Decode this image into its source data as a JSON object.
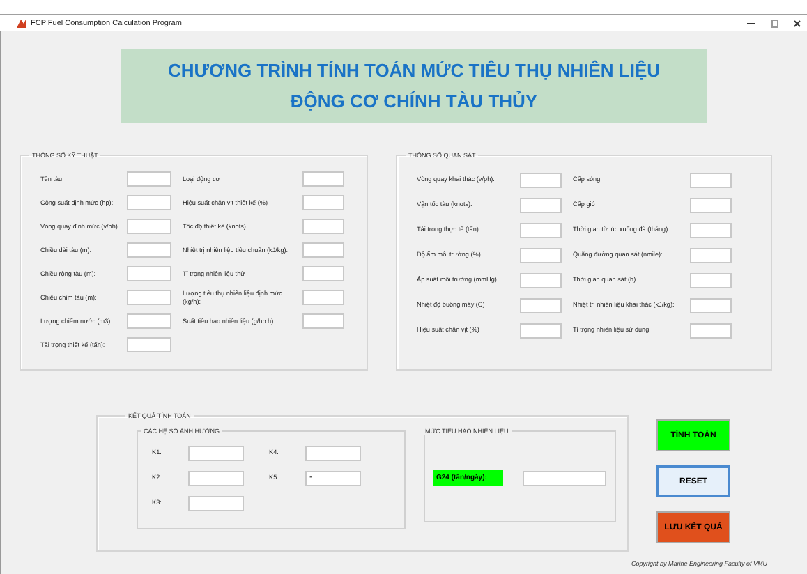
{
  "window": {
    "title": "FCP Fuel Consumption Calculation Program"
  },
  "banner": {
    "lines": [
      "CHƯƠNG TRÌNH TÍNH TOÁN MỨC TIÊU THỤ NHIÊN LIỆU",
      "ĐỘNG CƠ CHÍNH TÀU THỦY"
    ]
  },
  "technical": {
    "title": "THÔNG SỐ KỸ THUẬT",
    "columns": [
      [
        {
          "label": "Tên tàu"
        },
        {
          "label": "Công suất định mức (hp):"
        },
        {
          "label": "Vòng quay định mức (v/ph)"
        },
        {
          "label": "Chiều dài tàu (m):"
        },
        {
          "label": "Chiều rộng tàu (m):"
        },
        {
          "label": "Chiều chìm tàu (m):"
        },
        {
          "label": "Lượng chiếm nước (m3):"
        },
        {
          "label": "Tải trọng thiết kế (tấn):"
        }
      ],
      [
        {
          "label": "Loại động cơ"
        },
        {
          "label": "Hiệu suất chân vịt thiết kế (%)"
        },
        {
          "label": "Tốc độ thiết kế (knots)"
        },
        {
          "label": "Nhiệt trị nhiên liệu tiêu chuẩn (kJ/kg):"
        },
        {
          "label": "Tỉ trọng nhiên liệu thử"
        },
        {
          "label": "Lượng tiêu thụ nhiên liệu định mức (kg/h):"
        },
        {
          "label": "Suất tiêu hao nhiên liệu (g/hp.h):"
        }
      ]
    ]
  },
  "observed": {
    "title": "THÔNG SỐ QUAN SÁT",
    "columns": [
      [
        {
          "label": "Vòng quay khai thác (v/ph):"
        },
        {
          "label": "Vận tốc tàu (knots):"
        },
        {
          "label": "Tải trọng thực tế (tấn):"
        },
        {
          "label": "Độ ẩm môi trường (%)"
        },
        {
          "label": "Áp suất môi trường (mmHg)"
        },
        {
          "label": "Nhiệt độ buồng máy (C)"
        },
        {
          "label": "Hiệu suất chân vịt (%)"
        }
      ],
      [
        {
          "label": "Cấp sóng"
        },
        {
          "label": "Cấp gió"
        },
        {
          "label": "Thời gian từ lúc xuống đà (tháng):"
        },
        {
          "label": "Quãng đường quan sát (nmile):"
        },
        {
          "label": "Thời gian quan sát (h)"
        },
        {
          "label": "Nhiệt trị nhiên liệu khai thác (kJ/kg):"
        },
        {
          "label": "Tỉ trọng nhiên liệu sử dụng"
        }
      ]
    ]
  },
  "results": {
    "title": "KẾT QUẢ TÍNH TOÁN",
    "coefficients": {
      "title": "CÁC HỆ SỐ ẢNH HƯỞNG",
      "columns": [
        [
          {
            "label": "K1:"
          },
          {
            "label": "K2:"
          },
          {
            "label": "K3:"
          }
        ],
        [
          {
            "label": "K4:"
          },
          {
            "label": "K5:",
            "value": "-"
          }
        ]
      ]
    },
    "consumption": {
      "title": "MỨC TIÊU HAO NHIÊN LIỆU",
      "label": "G24 (tấn/ngày):"
    }
  },
  "buttons": [
    {
      "label": "TÍNH TOÁN",
      "kind": "compute"
    },
    {
      "label": "RESET",
      "kind": "reset"
    },
    {
      "label": "LƯU KẾT QUẢ",
      "kind": "save"
    }
  ],
  "copyright": "Copyright by Marine Engineering Faculty of VMU"
}
